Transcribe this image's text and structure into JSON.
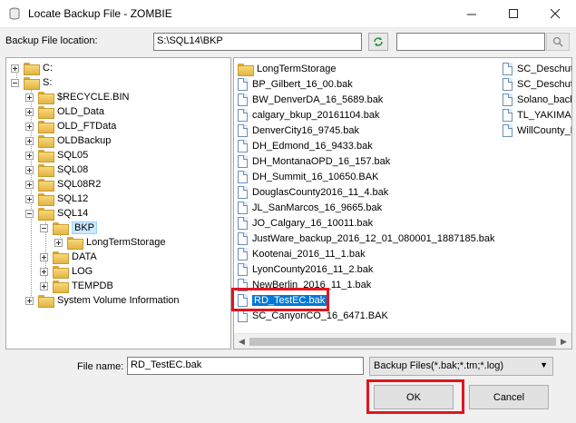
{
  "window": {
    "title": "Locate Backup File - ZOMBIE"
  },
  "location": {
    "label": "Backup File location:",
    "value": "S:\\SQL14\\BKP",
    "search_value": ""
  },
  "tree": [
    {
      "label": "C:",
      "expander": "plus"
    },
    {
      "label": "S:",
      "expander": "minus"
    },
    {
      "label": "$RECYCLE.BIN",
      "expander": "plus"
    },
    {
      "label": "OLD_Data",
      "expander": "plus"
    },
    {
      "label": "OLD_FTData",
      "expander": "plus"
    },
    {
      "label": "OLDBackup",
      "expander": "plus"
    },
    {
      "label": "SQL05",
      "expander": "plus"
    },
    {
      "label": "SQL08",
      "expander": "plus"
    },
    {
      "label": "SQL08R2",
      "expander": "plus"
    },
    {
      "label": "SQL12",
      "expander": "plus"
    },
    {
      "label": "SQL14",
      "expander": "minus"
    },
    {
      "label": "BKP",
      "expander": "minus",
      "selected": true
    },
    {
      "label": "LongTermStorage",
      "expander": "plus"
    },
    {
      "label": "DATA",
      "expander": "plus"
    },
    {
      "label": "LOG",
      "expander": "plus"
    },
    {
      "label": "TEMPDB",
      "expander": "plus"
    },
    {
      "label": "System Volume Information",
      "expander": "plus"
    }
  ],
  "files": {
    "column1": [
      {
        "label": "LongTermStorage",
        "type": "folder"
      },
      {
        "label": "BP_Gilbert_16_00.bak",
        "type": "file"
      },
      {
        "label": "BW_DenverDA_16_5689.bak",
        "type": "file"
      },
      {
        "label": "calgary_bkup_20161104.bak",
        "type": "file"
      },
      {
        "label": "DenverCity16_9745.bak",
        "type": "file"
      },
      {
        "label": "DH_Edmond_16_9433.bak",
        "type": "file"
      },
      {
        "label": "DH_MontanaOPD_16_157.bak",
        "type": "file"
      },
      {
        "label": "DH_Summit_16_10650.BAK",
        "type": "file"
      },
      {
        "label": "DouglasCounty2016_11_4.bak",
        "type": "file"
      },
      {
        "label": "JL_SanMarcos_16_9665.bak",
        "type": "file"
      },
      {
        "label": "JO_Calgary_16_10011.bak",
        "type": "file"
      },
      {
        "label": "JustWare_backup_2016_12_01_080001_1887185.bak",
        "type": "file"
      },
      {
        "label": "Kootenai_2016_11_1.bak",
        "type": "file"
      },
      {
        "label": "LyonCounty2016_11_2.bak",
        "type": "file"
      },
      {
        "label": "NewBerlin_2016_11_1.bak",
        "type": "file"
      },
      {
        "label": "RD_TestEC.bak",
        "type": "file",
        "selected": true
      },
      {
        "label": "SC_CanyonCO_16_6471.BAK",
        "type": "file"
      }
    ],
    "column2": [
      {
        "label": "SC_Deschute",
        "type": "file"
      },
      {
        "label": "SC_Deschute",
        "type": "file"
      },
      {
        "label": "Solano_back",
        "type": "file"
      },
      {
        "label": "TL_YAKIMA_",
        "type": "file"
      },
      {
        "label": "WillCounty_L",
        "type": "file"
      }
    ]
  },
  "footer": {
    "file_name_label": "File name:",
    "file_name_value": "RD_TestEC.bak",
    "filter_value": "Backup Files(*.bak;*.tm;*.log)",
    "ok_label": "OK",
    "cancel_label": "Cancel"
  },
  "colors": {
    "highlight": "#e3141d",
    "selection": "#0078d7"
  }
}
